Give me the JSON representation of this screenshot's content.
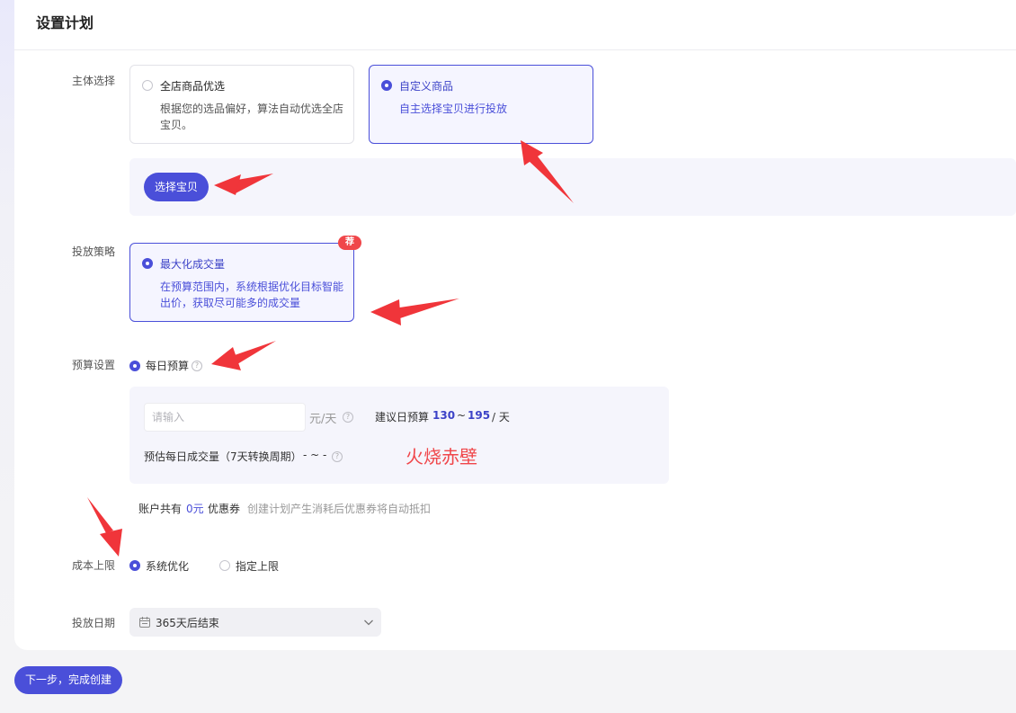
{
  "header": {
    "title": "设置计划"
  },
  "subject": {
    "label": "主体选择",
    "options": [
      {
        "title": "全店商品优选",
        "desc": "根据您的选品偏好，算法自动优选全店宝贝。",
        "selected": false
      },
      {
        "title": "自定义商品",
        "desc": "自主选择宝贝进行投放",
        "selected": true
      }
    ],
    "select_button": "选择宝贝"
  },
  "strategy": {
    "label": "投放策略",
    "badge": "荐",
    "option": {
      "title": "最大化成交量",
      "desc": "在预算范围内，系统根据优化目标智能出价，获取尽可能多的成交量",
      "selected": true
    }
  },
  "budget": {
    "label": "预算设置",
    "radio_label": "每日预算",
    "input_placeholder": "请输入",
    "input_value": "",
    "unit": "元/天",
    "suggest_label": "建议日预算",
    "suggest_min": "130",
    "suggest_sep": "~",
    "suggest_max": "195",
    "suggest_unit": "/ 天",
    "estimate_label": "预估每日成交量（7天转换周期）",
    "estimate_value": "- ~ -",
    "watermark": "火烧赤壁"
  },
  "coupon": {
    "prefix": "账户共有",
    "amount": "0元",
    "name": "优惠券",
    "note": "创建计划产生消耗后优惠券将自动抵扣"
  },
  "cost_limit": {
    "label": "成本上限",
    "options": [
      {
        "label": "系统优化",
        "selected": true
      },
      {
        "label": "指定上限",
        "selected": false
      }
    ]
  },
  "schedule": {
    "label": "投放日期",
    "value": "365天后结束"
  },
  "footer": {
    "next_button": "下一步，完成创建"
  },
  "colors": {
    "accent": "#4a4fd9",
    "annotation_red": "#f0464a",
    "badge_red": "#f0464a"
  },
  "icons": [
    "calendar-icon",
    "chevron-down-icon",
    "help-icon"
  ]
}
